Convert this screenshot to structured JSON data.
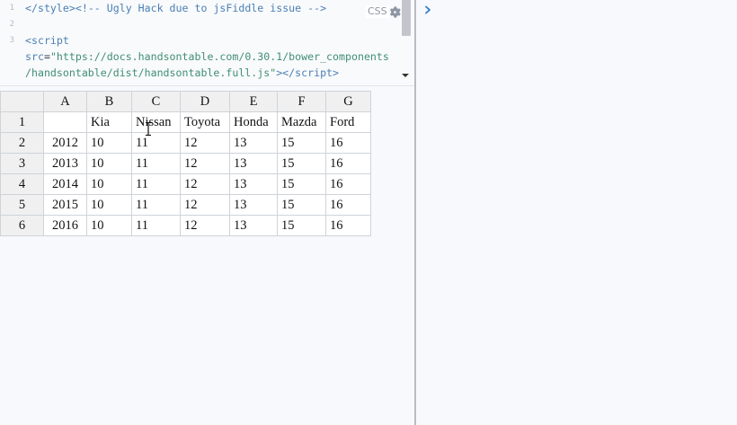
{
  "editor": {
    "lines": [
      {
        "number": "1",
        "parts": [
          {
            "t": "</",
            "c": "tag"
          },
          {
            "t": "style",
            "c": "tag"
          },
          {
            "t": ">",
            "c": "tag"
          },
          {
            "t": "<!-- Ugly Hack due to jsFiddle issue -->",
            "c": "comment"
          }
        ]
      },
      {
        "number": "2",
        "parts": []
      },
      {
        "number": "3",
        "parts": [
          {
            "t": "<",
            "c": "tag"
          },
          {
            "t": "script",
            "c": "tag"
          }
        ]
      },
      {
        "number": "",
        "parts": [
          {
            "t": "src",
            "c": "attr"
          },
          {
            "t": "=",
            "c": "plain"
          },
          {
            "t": "\"https://docs.handsontable.com/0.30.1/bower_components",
            "c": "str"
          }
        ]
      },
      {
        "number": "",
        "parts": [
          {
            "t": "/handsontable/dist/handsontable.full.js\"",
            "c": "str"
          },
          {
            "t": "></",
            "c": "tag"
          },
          {
            "t": "script",
            "c": "tag"
          },
          {
            "t": ">",
            "c": "tag"
          }
        ]
      }
    ],
    "panel_label": "CSS",
    "settings_icon": "gear-icon"
  },
  "result_pane": {
    "toggle_icon": "chevron-right-icon"
  },
  "grid": {
    "col_headers": [
      "A",
      "B",
      "C",
      "D",
      "E",
      "F",
      "G"
    ],
    "rows": [
      {
        "header": "1",
        "cells": [
          "",
          "Kia",
          "Nissan",
          "Toyota",
          "Honda",
          "Mazda",
          "Ford"
        ]
      },
      {
        "header": "2",
        "cells": [
          "2012",
          "10",
          "11",
          "12",
          "13",
          "15",
          "16"
        ]
      },
      {
        "header": "3",
        "cells": [
          "2013",
          "10",
          "11",
          "12",
          "13",
          "15",
          "16"
        ]
      },
      {
        "header": "4",
        "cells": [
          "2014",
          "10",
          "11",
          "12",
          "13",
          "15",
          "16"
        ]
      },
      {
        "header": "5",
        "cells": [
          "2015",
          "10",
          "11",
          "12",
          "13",
          "15",
          "16"
        ]
      },
      {
        "header": "6",
        "cells": [
          "2016",
          "10",
          "11",
          "12",
          "13",
          "15",
          "16"
        ]
      }
    ]
  },
  "colors": {
    "divider": "#b8bcc2",
    "code_tag": "#4a7fb5",
    "code_string": "#3f8f72",
    "chevron": "#2f7bd0"
  }
}
